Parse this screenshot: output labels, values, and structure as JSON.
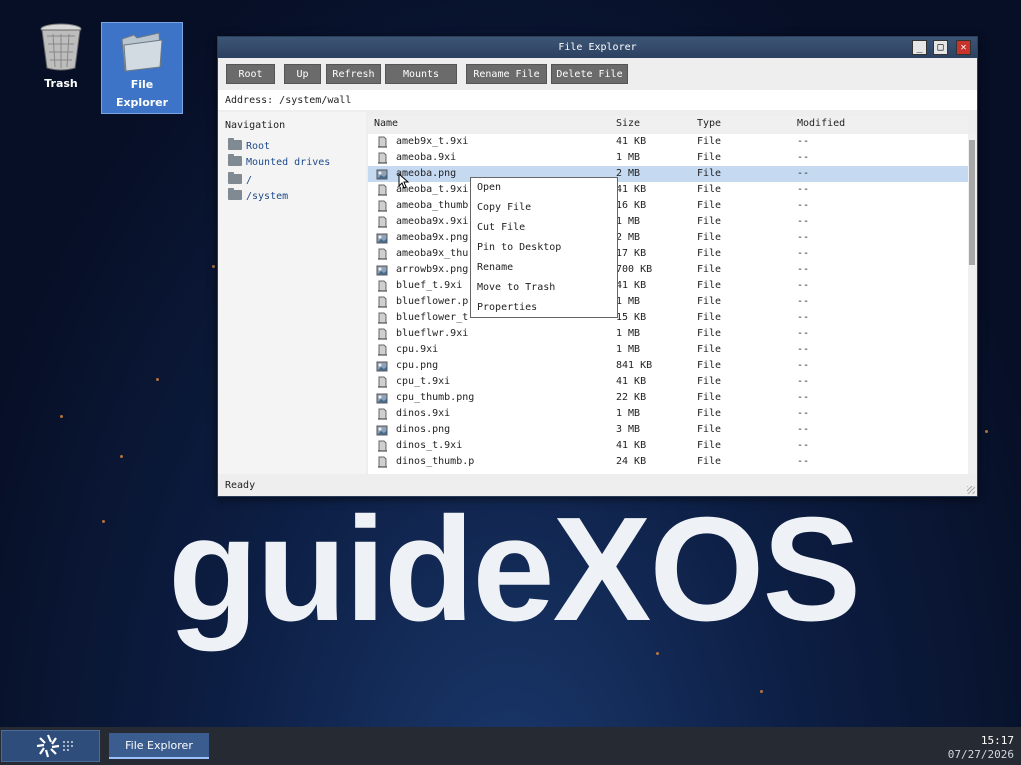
{
  "desktop": {
    "icons": [
      {
        "label": "Trash",
        "icon": "trash-icon"
      },
      {
        "label1": "File",
        "label2": "Explorer",
        "icon": "folder-icon"
      }
    ],
    "logo_text": "guideXOS"
  },
  "window": {
    "title": "File Explorer",
    "controls": {
      "minimize": "_",
      "maximize": "□",
      "close": "✕"
    },
    "toolbar": {
      "root": "Root",
      "up": "Up",
      "refresh": "Refresh",
      "mounts": "Mounts",
      "rename": "Rename File",
      "delete": "Delete File"
    },
    "address": "Address: /system/wall",
    "navigation": {
      "heading": "Navigation",
      "items": [
        "Root",
        "Mounted drives",
        "/",
        "/system"
      ]
    },
    "columns": {
      "name": "Name",
      "size": "Size",
      "type": "Type",
      "modified": "Modified"
    },
    "files": [
      {
        "name": "ameb9x_t.9xi",
        "size": "41 KB",
        "type": "File",
        "modified": "--",
        "kind": "file"
      },
      {
        "name": "ameoba.9xi",
        "size": "1 MB",
        "type": "File",
        "modified": "--",
        "kind": "file"
      },
      {
        "name": "ameoba.png",
        "size": "2 MB",
        "type": "File",
        "modified": "--",
        "kind": "image"
      },
      {
        "name": "ameoba_t.9xi",
        "size": "41 KB",
        "type": "File",
        "modified": "--",
        "kind": "file"
      },
      {
        "name": "ameoba_thumb",
        "size": "16 KB",
        "type": "File",
        "modified": "--",
        "kind": "file"
      },
      {
        "name": "ameoba9x.9xi",
        "size": "1 MB",
        "type": "File",
        "modified": "--",
        "kind": "file"
      },
      {
        "name": "ameoba9x.png",
        "size": "2 MB",
        "type": "File",
        "modified": "--",
        "kind": "image"
      },
      {
        "name": "ameoba9x_thu",
        "size": "17 KB",
        "type": "File",
        "modified": "--",
        "kind": "file"
      },
      {
        "name": "arrowb9x.png",
        "size": "700 KB",
        "type": "File",
        "modified": "--",
        "kind": "image"
      },
      {
        "name": "bluef_t.9xi",
        "size": "41 KB",
        "type": "File",
        "modified": "--",
        "kind": "file"
      },
      {
        "name": "blueflower.p",
        "size": "1 MB",
        "type": "File",
        "modified": "--",
        "kind": "file"
      },
      {
        "name": "blueflower_t",
        "size": "15 KB",
        "type": "File",
        "modified": "--",
        "kind": "file"
      },
      {
        "name": "blueflwr.9xi",
        "size": "1 MB",
        "type": "File",
        "modified": "--",
        "kind": "file"
      },
      {
        "name": "cpu.9xi",
        "size": "1 MB",
        "type": "File",
        "modified": "--",
        "kind": "file"
      },
      {
        "name": "cpu.png",
        "size": "841 KB",
        "type": "File",
        "modified": "--",
        "kind": "image"
      },
      {
        "name": "cpu_t.9xi",
        "size": "41 KB",
        "type": "File",
        "modified": "--",
        "kind": "file"
      },
      {
        "name": "cpu_thumb.png",
        "size": "22 KB",
        "type": "File",
        "modified": "--",
        "kind": "image"
      },
      {
        "name": "dinos.9xi",
        "size": "1 MB",
        "type": "File",
        "modified": "--",
        "kind": "file"
      },
      {
        "name": "dinos.png",
        "size": "3 MB",
        "type": "File",
        "modified": "--",
        "kind": "image"
      },
      {
        "name": "dinos_t.9xi",
        "size": "41 KB",
        "type": "File",
        "modified": "--",
        "kind": "file"
      },
      {
        "name": "dinos_thumb.p",
        "size": "24 KB",
        "type": "File",
        "modified": "--",
        "kind": "file"
      }
    ],
    "selected_index": 2,
    "status": "Ready"
  },
  "context_menu": {
    "items": [
      "Open",
      "Copy File",
      "Cut File",
      "Pin to Desktop",
      "Rename",
      "Move to Trash",
      "Properties"
    ]
  },
  "taskbar": {
    "task_label": "File Explorer",
    "time": "15:17",
    "date": "07/27/2026"
  }
}
